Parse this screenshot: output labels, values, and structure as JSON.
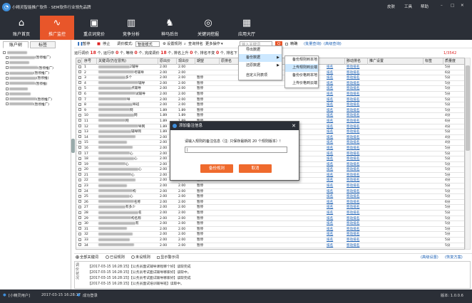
{
  "app": {
    "title": "小精灵智能推广软件 · SEM软件行业领先品牌",
    "top_right": [
      "皮肤",
      "工具",
      "帮助"
    ],
    "win_controls": [
      "–",
      "□",
      "✕"
    ]
  },
  "nav": {
    "items": [
      {
        "label": "账户首页",
        "icon": "⌂"
      },
      {
        "label": "推广监控",
        "icon": "∿"
      },
      {
        "label": "重点词竞价",
        "icon": "▣"
      },
      {
        "label": "竞争分析",
        "icon": "▥"
      },
      {
        "label": "神马后台",
        "icon": "♞"
      },
      {
        "label": "关键词挖掘",
        "icon": "◎"
      },
      {
        "label": "应用大厅",
        "icon": "▦"
      }
    ]
  },
  "left": {
    "tabs": [
      "账户树",
      "标签"
    ],
    "tree_root": "",
    "tree_items": [
      {
        "suffix": "(暂停推广)"
      },
      {
        "suffix": ""
      },
      {
        "suffix": "(暂停推广)"
      },
      {
        "suffix": "(暂停推广)"
      },
      {
        "suffix": "(暂停推)"
      },
      {
        "suffix": "(暂停推)"
      },
      {
        "suffix": ""
      },
      {
        "suffix": ""
      },
      {
        "suffix": "(暂停推广)"
      },
      {
        "suffix": "(暂停推广)"
      }
    ]
  },
  "toolbar": {
    "pause": "暂停",
    "stop": "停止",
    "mode_label": "调价模式:",
    "mode_value": "智能模式",
    "set_rule": "设置规则",
    "query_rank": "查询排名",
    "more_ops": "更多操作",
    "search_placeholder": "输入关键词",
    "search_btn": "Q",
    "exact": "精确",
    "bulk_query": "(批量查询)",
    "advanced_query": "(高级查询)"
  },
  "status": {
    "t1": "运行调价",
    "v1": "18",
    "t2": "个, 运行中",
    "v2": "0",
    "t3": "个, 等待",
    "v3": "0",
    "t4": "个, 完成调价",
    "v4": "18",
    "t5": "个, 排名上升",
    "v5": "0",
    "t6": "个, 排名不变",
    "v6": "0",
    "t7": "个, 排名下",
    "page": "1/3542"
  },
  "table": {
    "headers": [
      "序号",
      "关键词(仍在冒热)",
      "原出价",
      "现出价",
      "期望",
      "原排名",
      "",
      "",
      "",
      "移动排名",
      "推广设置",
      "标签",
      "质量度"
    ],
    "link_pc": "排名",
    "link_mobile": "移动排名",
    "rows": [
      {
        "n": "1",
        "p1": "2.00",
        "p2": "2.00",
        "rk": "",
        "q": "5分",
        "kw": "2辅导"
      },
      {
        "n": "2",
        "p1": "2.00",
        "p2": "2.00",
        "rk": "",
        "q": "6分",
        "kw": "考辅导"
      },
      {
        "n": "3",
        "p1": "2.00",
        "p2": "2.00",
        "rk": "暂停",
        "q": "5分",
        "kw": "多个"
      },
      {
        "n": "4",
        "p1": "2.00",
        "p2": "2.00",
        "rk": "暂停",
        "q": "5分",
        "kw": "辅导"
      },
      {
        "n": "5",
        "p1": "2.00",
        "p2": "2.00",
        "rk": "暂停",
        "q": "5分",
        "kw": "点辅导"
      },
      {
        "n": "6",
        "p1": "2.00",
        "p2": "2.00",
        "rk": "暂停",
        "q": "5分",
        "kw": "试辅导"
      },
      {
        "n": "7",
        "p1": "2.00",
        "p2": "2.00",
        "rk": "暂停",
        "q": "5分",
        "kw": "导"
      },
      {
        "n": "8",
        "p1": "2.00",
        "p2": "2.00",
        "rk": "暂停",
        "q": "5分",
        "kw": "导班"
      },
      {
        "n": "9",
        "p1": "1.89",
        "p2": "1.89",
        "rk": "暂停",
        "q": "5分",
        "kw": "网"
      },
      {
        "n": "10",
        "p1": "1.89",
        "p2": "1.89",
        "rk": "暂停",
        "q": "4分",
        "kw": "网"
      },
      {
        "n": "11",
        "p1": "1.89",
        "p2": "1.89",
        "rk": "暂停",
        "q": "6分",
        "kw": "网"
      },
      {
        "n": "12",
        "p1": "1.89",
        "p2": "1.89",
        "rk": "暂停",
        "q": "4分",
        "kw": "导网"
      },
      {
        "n": "13",
        "p1": "1.89",
        "p2": "1.89",
        "rk": "暂停",
        "q": "5分",
        "kw": "辅导网"
      },
      {
        "n": "14",
        "p1": "2.00",
        "p2": "2.00",
        "rk": "暂停",
        "q": "4分",
        "kw": ""
      },
      {
        "n": "15",
        "p1": "2.00",
        "p2": "2.00",
        "rk": "暂停",
        "q": "4分",
        "kw": ""
      },
      {
        "n": "16",
        "p1": "2.00",
        "p2": "2.00",
        "rk": "暂停",
        "q": "5分",
        "kw": ""
      },
      {
        "n": "17",
        "p1": "2.00",
        "p2": "2.00",
        "rk": "暂停",
        "q": "5分",
        "kw": "心"
      },
      {
        "n": "18",
        "p1": "2.00",
        "p2": "2.00",
        "rk": "暂停",
        "q": "5分",
        "kw": "心"
      },
      {
        "n": "19",
        "p1": "2.00",
        "p2": "2.00",
        "rk": "暂停",
        "q": "5分",
        "kw": "心"
      },
      {
        "n": "20",
        "p1": "2.00",
        "p2": "2.00",
        "rk": "暂停",
        "q": "5分",
        "kw": "心"
      },
      {
        "n": "21",
        "p1": "2.00",
        "p2": "2.00",
        "rk": "暂停",
        "q": "5分",
        "kw": "心"
      },
      {
        "n": "22",
        "p1": "2.00",
        "p2": "2.00",
        "rk": "暂停",
        "q": "4分",
        "kw": ""
      },
      {
        "n": "23",
        "p1": "2.00",
        "p2": "2.00",
        "rk": "暂停",
        "q": "5分",
        "kw": ""
      },
      {
        "n": "24",
        "p1": "2.00",
        "p2": "2.00",
        "rk": "暂停",
        "q": "5分",
        "kw": "构"
      },
      {
        "n": "25",
        "p1": "2.00",
        "p2": "2.00",
        "rk": "暂停",
        "q": "5分",
        "kw": "心"
      },
      {
        "n": "26",
        "p1": "2.00",
        "p2": "2.00",
        "rk": "暂停",
        "q": "6分",
        "kw": "名称"
      },
      {
        "n": "27",
        "p1": "2.00",
        "p2": "2.00",
        "rk": "暂停",
        "q": "5分",
        "kw": "有多少"
      },
      {
        "n": "28",
        "p1": "2.00",
        "p2": "2.00",
        "rk": "暂停",
        "q": "5分",
        "kw": "名"
      },
      {
        "n": "29",
        "p1": "2.00",
        "p2": "2.00",
        "rk": "暂停",
        "q": "5分",
        "kw": "构名称"
      },
      {
        "n": "30",
        "p1": "2.00",
        "p2": "2.00",
        "rk": "暂停",
        "q": "5分",
        "kw": "有"
      },
      {
        "n": "31",
        "p1": "2.00",
        "p2": "2.00",
        "rk": "暂停",
        "q": "5分",
        "kw": ""
      },
      {
        "n": "32",
        "p1": "2.00",
        "p2": "2.00",
        "rk": "暂停",
        "q": "5分",
        "kw": ""
      },
      {
        "n": "33",
        "p1": "2.00",
        "p2": "2.00",
        "rk": "暂停",
        "q": "5分",
        "kw": ""
      },
      {
        "n": "34",
        "p1": "2.00",
        "p2": "2.00",
        "rk": "暂停",
        "q": "5分",
        "kw": ""
      }
    ]
  },
  "menu": {
    "items": [
      "导出数据",
      "备份数据",
      "还原数据",
      "自定义列表项"
    ],
    "sub_items": [
      "备份规则到本地",
      "上传规则到云端",
      "备份价格到本地",
      "上传价格到云端"
    ]
  },
  "dialog": {
    "title": "添加备注信息",
    "prompt": "请输入规则的备注信息（注: 只保存最新的 20 个规则版本）!",
    "input_value": "|",
    "ok": "备份规则",
    "cancel": "取消"
  },
  "radiobar": {
    "options": [
      "全部关键词",
      "已设规则",
      "未设规则"
    ],
    "show_warn": "显示警示词",
    "right_link1": "(高级设置)",
    "right_link2": "(恢复方案)"
  },
  "log": {
    "label": "调价状况",
    "lines": [
      "【2017-03-15 16:28:15】【公务员面试辅导课程哪个好】读取完成",
      "【2017-03-15 16:28:15】【公务员考试面试辅导哪家好】读取中。",
      "【2017-03-15 16:28:15】【公务员考试面试辅导哪家好】读取完成",
      "【2017-03-15 16:28:15】【公务员面试培训辅导班】读取中。"
    ]
  },
  "footer": {
    "user": "[小精灵用户]",
    "date": "2017-03-15 16:28:17",
    "status": "成功登录",
    "version": "版本: 1.0.0.6"
  },
  "colors": {
    "dark": "#2b2f37",
    "accent": "#e8562a",
    "link": "#1a5fb4"
  }
}
